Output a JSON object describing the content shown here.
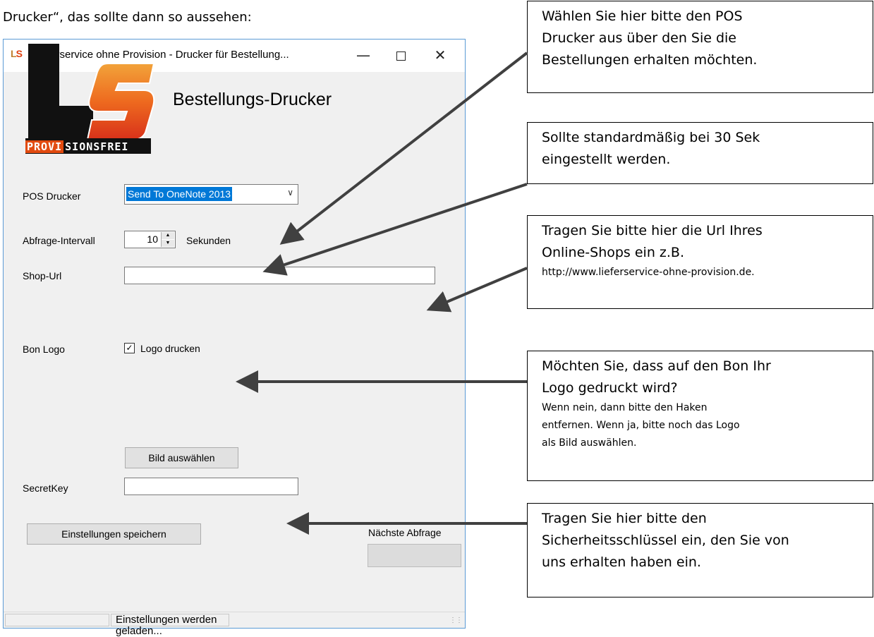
{
  "intro_text": "Drucker“, das sollte dann so aussehen:",
  "window": {
    "title": "Lieferservice ohne Provision - Drucker für Bestellung...",
    "icon_text": "LS",
    "controls": {
      "minimize": "—",
      "close": "✕"
    }
  },
  "logo": {
    "text": "PROVISIONSFREI",
    "part1": "PROVI",
    "part2": "SIONSFREI"
  },
  "heading": "Bestellungs-Drucker",
  "form": {
    "pos_label": "POS Drucker",
    "pos_value": "Send To OneNote 2013",
    "interval_label": "Abfrage-Intervall",
    "interval_value": "10",
    "interval_unit": "Sekunden",
    "shop_label": "Shop-Url",
    "shop_value": "",
    "bonlogo_label": "Bon Logo",
    "logo_checkbox_label": "Logo drucken",
    "logo_checked": true,
    "choose_image_button": "Bild auswählen",
    "secret_label": "SecretKey",
    "secret_value": "",
    "save_button": "Einstellungen speichern",
    "next_label": "Nächste Abfrage"
  },
  "status": {
    "text": "Einstellungen werden geladen..."
  },
  "callouts": {
    "c1": {
      "line1": "Wählen Sie hier bitte den POS",
      "line2": "Drucker aus über den Sie die",
      "line3": "Bestellungen erhalten möchten."
    },
    "c2": {
      "line1": "Sollte standardmäßig bei 30 Sek",
      "line2": "eingestellt werden."
    },
    "c3": {
      "line1": "Tragen Sie bitte hier die Url Ihres",
      "line2": "Online-Shops ein z.B.",
      "line3": "http://www.lieferservice-ohne-provision.de."
    },
    "c4": {
      "line1": "Möchten Sie, dass auf den Bon Ihr",
      "line2": "Logo gedruckt wird?",
      "line3": "Wenn nein, dann bitte den Haken",
      "line4": "entfernen. Wenn ja, bitte noch das Logo",
      "line5": "als Bild auswählen."
    },
    "c5": {
      "line1": "Tragen Sie hier bitte den",
      "line2": "Sicherheitsschlüssel ein, den Sie von",
      "line3": "uns erhalten haben ein."
    }
  },
  "colors": {
    "accent_blue": "#0078d7",
    "window_border": "#5b9bd5",
    "logo_orange": "#e24b10",
    "arrow": "#404040"
  }
}
